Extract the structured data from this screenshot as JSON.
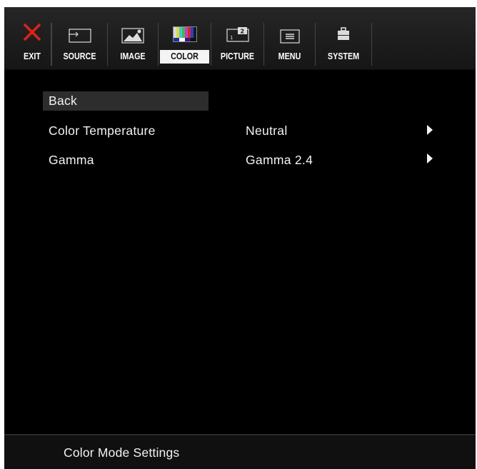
{
  "tabs": [
    {
      "label": "EXIT",
      "icon": "close-icon",
      "active": false
    },
    {
      "label": "SOURCE",
      "icon": "input-source-icon",
      "active": false
    },
    {
      "label": "IMAGE",
      "icon": "image-icon",
      "active": false
    },
    {
      "label": "COLOR",
      "icon": "color-bars-icon",
      "active": true
    },
    {
      "label": "PICTURE",
      "icon": "picture-in-picture-icon",
      "active": false
    },
    {
      "label": "MENU",
      "icon": "menu-icon",
      "active": false
    },
    {
      "label": "SYSTEM",
      "icon": "toolbox-icon",
      "active": false
    }
  ],
  "menu": {
    "back": "Back",
    "items": [
      {
        "label": "Color Temperature",
        "value": "Neutral",
        "has_submenu": true
      },
      {
        "label": "Gamma",
        "value": "Gamma 2.4",
        "has_submenu": true
      }
    ]
  },
  "status": {
    "text": "Color Mode Settings"
  },
  "colors": {
    "exit_icon": "#e0201c",
    "background": "#000000",
    "active_tab": "#f4f4f4"
  }
}
